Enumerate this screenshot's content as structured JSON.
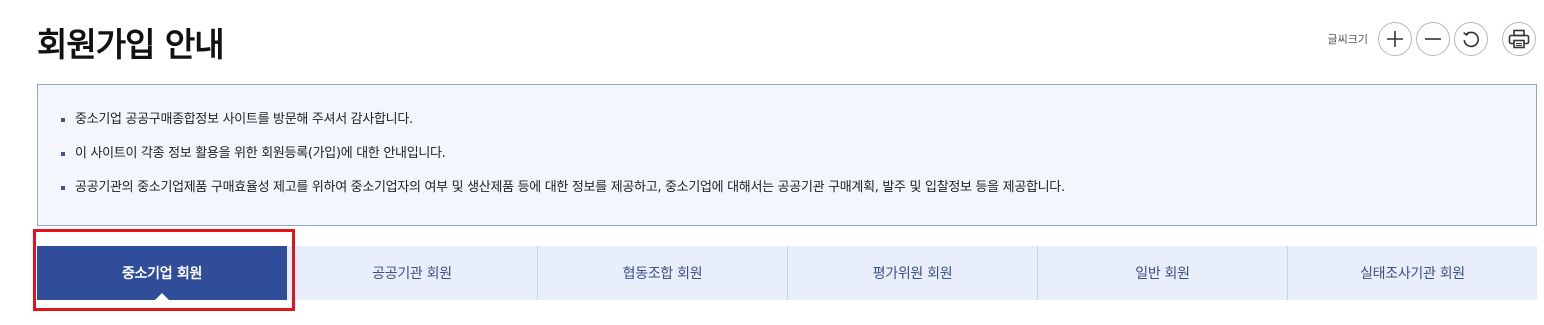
{
  "page": {
    "title": "회원가입 안내"
  },
  "font_tools": {
    "label": "글씨크기",
    "buttons": [
      {
        "name": "font-increase",
        "icon": "plus-icon"
      },
      {
        "name": "font-decrease",
        "icon": "minus-icon"
      },
      {
        "name": "font-reset",
        "icon": "refresh-icon"
      },
      {
        "name": "print",
        "icon": "print-icon"
      }
    ]
  },
  "info": {
    "items": [
      "중소기업 공공구매종합정보 사이트를 방문해 주셔서 감사합니다.",
      "이 사이트이 각종 정보 활용을 위한 회원등록(가입)에 대한 안내입니다.",
      "공공기관의 중소기업제품 구매효율성 제고를 위하여 중소기업자의 여부 및 생산제품 등에 대한 정보를 제공하고, 중소기업에 대해서는 공공기관 구매계획, 발주 및 입찰정보 등을 제공합니다."
    ]
  },
  "tabs": [
    {
      "label": "중소기업 회원",
      "active": true
    },
    {
      "label": "공공기관 회원",
      "active": false
    },
    {
      "label": "협동조합 회원",
      "active": false
    },
    {
      "label": "평가위원 회원",
      "active": false
    },
    {
      "label": "일반 회원",
      "active": false
    },
    {
      "label": "실태조사기관 회원",
      "active": false
    }
  ],
  "colors": {
    "active_tab": "#2f4d98",
    "tab_bg": "#e9effa",
    "tab_text": "#3d4f86",
    "info_bg": "#f3f7fd",
    "info_border": "#8fa6c6",
    "bullet": "#3a5498",
    "highlight": "#e0141e"
  }
}
